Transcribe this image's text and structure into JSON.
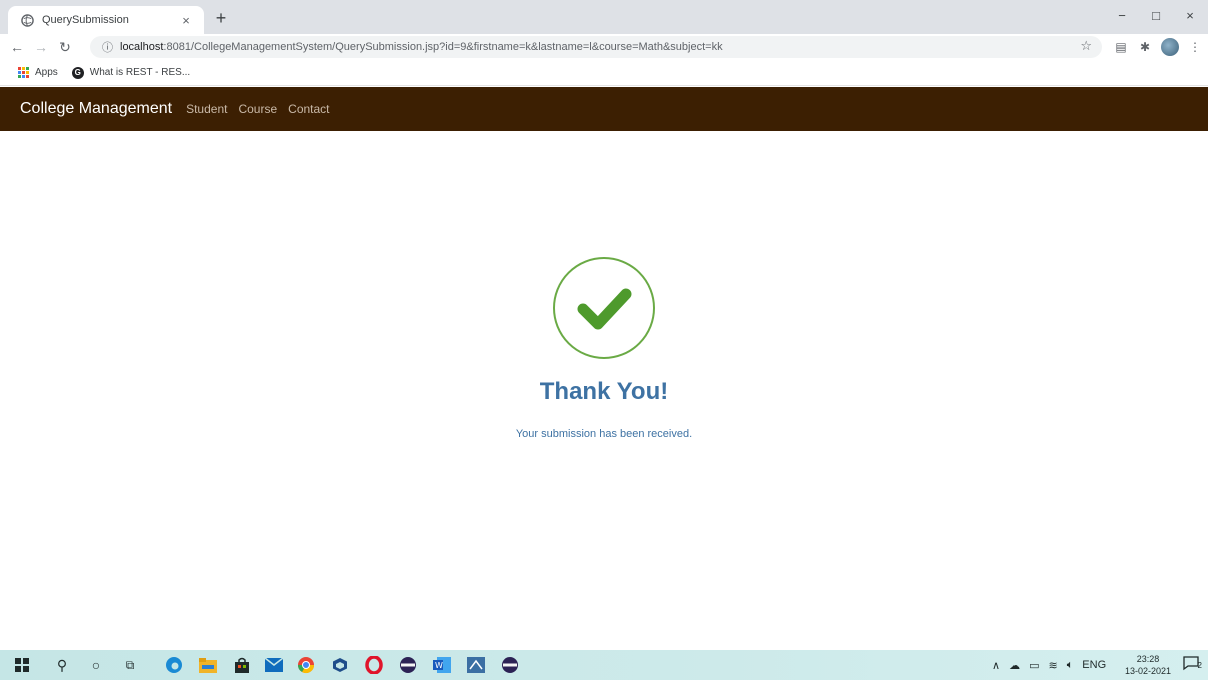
{
  "browser": {
    "tab_title": "QuerySubmission",
    "tab_close": "×",
    "new_tab": "+",
    "window_minimize": "−",
    "window_restore": "□",
    "window_close": "×",
    "url_host": "localhost",
    "url_rest": ":8081/CollegeManagementSystem/QuerySubmission.jsp?id=9&firstname=k&lastname=l&course=Math&subject=kk",
    "bookmarks": [
      {
        "label": "Apps"
      },
      {
        "label": "What is REST - RES..."
      }
    ]
  },
  "app": {
    "brand": "College Management",
    "nav": [
      "Student",
      "Course",
      "Contact"
    ]
  },
  "content": {
    "heading": "Thank You!",
    "message": "Your submission has been received."
  },
  "taskbar": {
    "language": "ENG",
    "time": "23:28",
    "date": "13-02-2021",
    "notification_count": "2"
  },
  "colors": {
    "navbar": "#3c1f02",
    "success_green": "#4e9a2c",
    "heading_blue": "#3e72a3"
  }
}
